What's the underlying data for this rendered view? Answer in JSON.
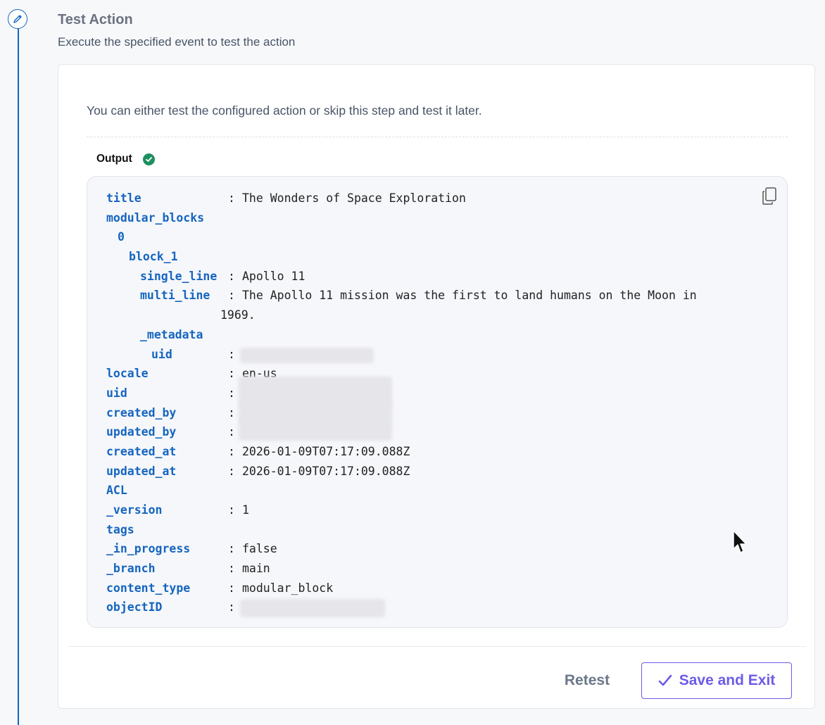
{
  "step": {
    "title": "Test Action",
    "subtitle": "Execute the specified event to test the action"
  },
  "card": {
    "description": "You can either test the configured action or skip this step and test it later.",
    "output_label": "Output",
    "output_status": "success"
  },
  "output": {
    "title": {
      "key": "title",
      "value": "The Wonders of Space Exploration"
    },
    "modular_blocks": {
      "key": "modular_blocks"
    },
    "index0": {
      "key": "0"
    },
    "block_1": {
      "key": "block_1"
    },
    "single_line": {
      "key": "single_line",
      "value": "Apollo 11"
    },
    "multi_line": {
      "key": "multi_line",
      "value": "The Apollo 11 mission was the first to land humans on the Moon in 1969."
    },
    "metadata": {
      "key": "_metadata"
    },
    "meta_uid": {
      "key": "uid",
      "value": ""
    },
    "locale": {
      "key": "locale",
      "value": "en-us"
    },
    "uid": {
      "key": "uid",
      "value": ""
    },
    "created_by": {
      "key": "created_by",
      "value": ""
    },
    "updated_by": {
      "key": "updated_by",
      "value": ""
    },
    "created_at": {
      "key": "created_at",
      "value": "2026-01-09T07:17:09.088Z"
    },
    "updated_at": {
      "key": "updated_at",
      "value": "2026-01-09T07:17:09.088Z"
    },
    "acl": {
      "key": "ACL"
    },
    "version": {
      "key": "_version",
      "value": "1"
    },
    "tags": {
      "key": "tags"
    },
    "in_progress": {
      "key": "_in_progress",
      "value": "false"
    },
    "branch": {
      "key": "_branch",
      "value": "main"
    },
    "content_type": {
      "key": "content_type",
      "value": "modular_block"
    },
    "object_id": {
      "key": "objectID",
      "value": ""
    }
  },
  "buttons": {
    "retest": "Retest",
    "save_exit": "Save and Exit"
  },
  "colors": {
    "accent": "#1565c0",
    "primary_button": "#6c5ce7",
    "success": "#1f8f5f"
  },
  "icons": {
    "step": "pencil-icon",
    "status": "check-circle-icon",
    "copy": "copy-icon",
    "save": "checkmark-icon"
  }
}
